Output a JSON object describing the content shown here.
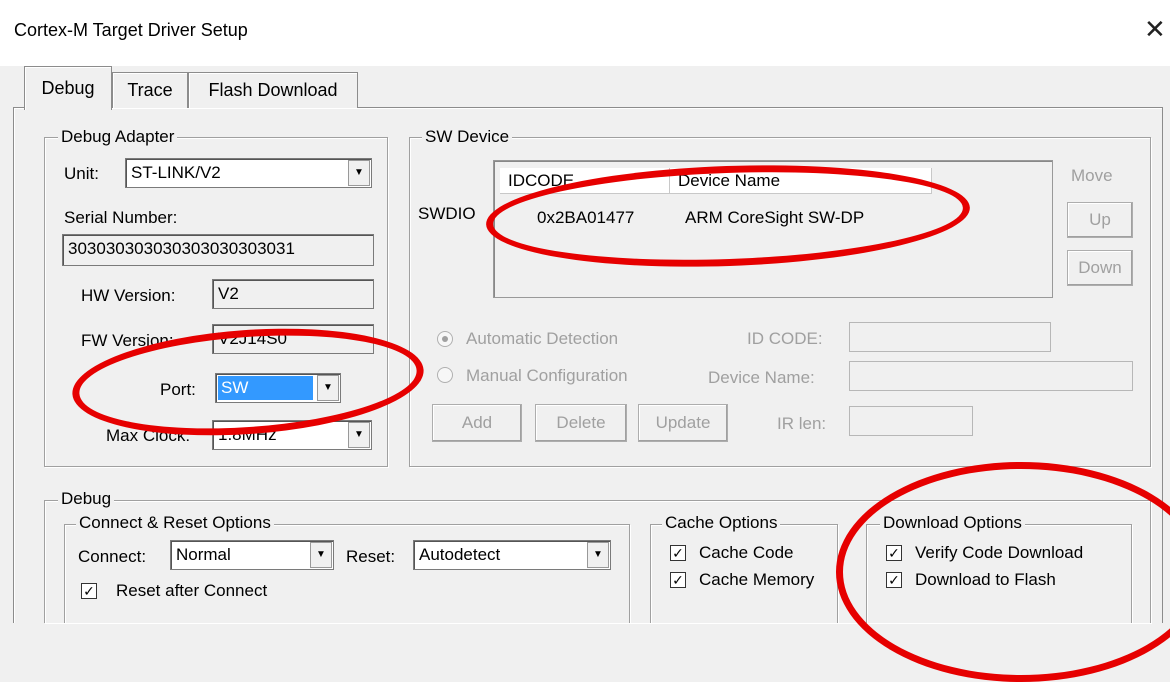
{
  "window": {
    "title": "Cortex-M Target Driver Setup",
    "close_glyph": "✕"
  },
  "tabs": [
    {
      "label": "Debug",
      "active": true
    },
    {
      "label": "Trace",
      "active": false
    },
    {
      "label": "Flash Download",
      "active": false
    }
  ],
  "debug_adapter": {
    "legend": "Debug Adapter",
    "unit_label": "Unit:",
    "unit_value": "ST-LINK/V2",
    "serial_label": "Serial Number:",
    "serial_value": "303030303030303030303031",
    "hw_label": "HW Version:",
    "hw_value": "V2",
    "fw_label": "FW Version:",
    "fw_value": "V2J14S0",
    "port_label": "Port:",
    "port_value": "SW",
    "clock_label": "Max Clock:",
    "clock_value": "1.8MHz"
  },
  "sw_device": {
    "legend": "SW Device",
    "row_label": "SWDIO",
    "columns": [
      "IDCODE",
      "Device Name"
    ],
    "rows": [
      {
        "idcode": "0x2BA01477",
        "device_name": "ARM CoreSight SW-DP"
      }
    ],
    "move_label": "Move",
    "up_label": "Up",
    "down_label": "Down",
    "auto_label": "Automatic Detection",
    "manual_label": "Manual Configuration",
    "idcode_label": "ID CODE:",
    "device_name_label": "Device Name:",
    "irlen_label": "IR len:",
    "add_label": "Add",
    "delete_label": "Delete",
    "update_label": "Update"
  },
  "debug": {
    "legend": "Debug",
    "connect_reset": {
      "legend": "Connect & Reset Options",
      "connect_label": "Connect:",
      "connect_value": "Normal",
      "reset_label": "Reset:",
      "reset_value": "Autodetect",
      "reset_after_connect_label": "Reset after Connect",
      "reset_after_connect_checked": true
    },
    "cache": {
      "legend": "Cache Options",
      "cache_code_label": "Cache Code",
      "cache_code_checked": true,
      "cache_memory_label": "Cache Memory",
      "cache_memory_checked": true
    },
    "download": {
      "legend": "Download Options",
      "verify_label": "Verify Code Download",
      "verify_checked": true,
      "flash_label": "Download to Flash",
      "flash_checked": true
    }
  },
  "colors": {
    "annotation": "#e60000",
    "selection": "#3399ff"
  },
  "check_glyph": "✓"
}
